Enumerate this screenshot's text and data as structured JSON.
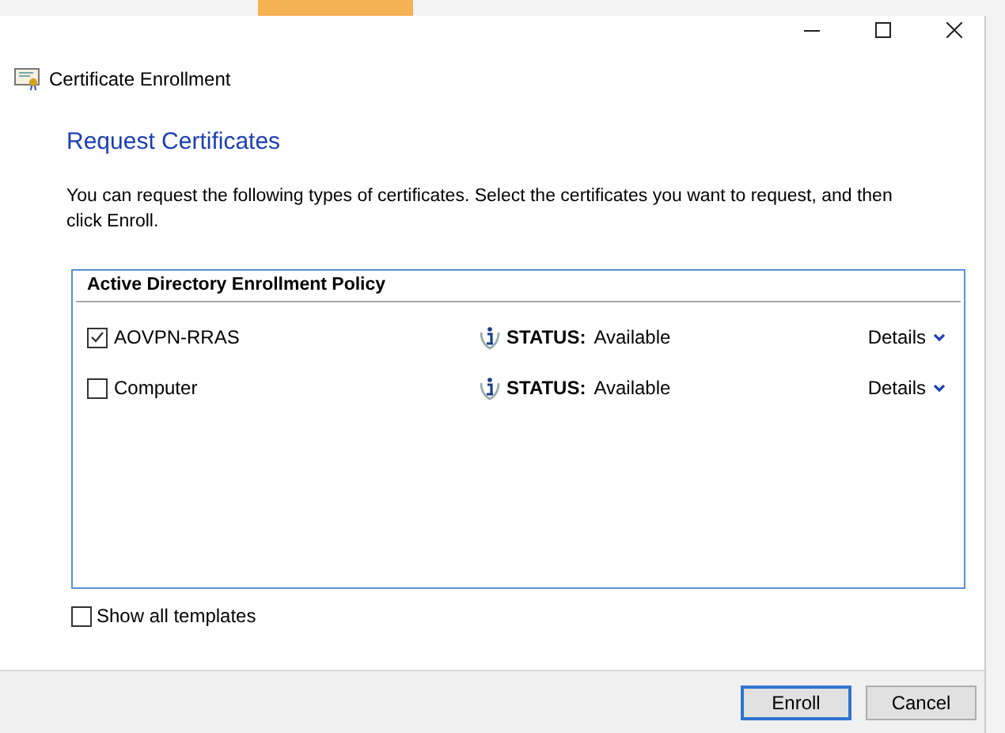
{
  "window": {
    "title": "Certificate Enrollment"
  },
  "heading": "Request Certificates",
  "description": "You can request the following types of certificates. Select the certificates you want to request, and then click Enroll.",
  "policy": {
    "title": "Active Directory Enrollment Policy",
    "certificates": [
      {
        "name": "AOVPN-RRAS",
        "checked": true,
        "status_label": "STATUS:",
        "status": "Available",
        "details": "Details"
      },
      {
        "name": "Computer",
        "checked": false,
        "status_label": "STATUS:",
        "status": "Available",
        "details": "Details"
      }
    ]
  },
  "show_all_templates": {
    "label": "Show all templates",
    "checked": false
  },
  "buttons": [
    {
      "label": "Enroll",
      "default": true
    },
    {
      "label": "Cancel",
      "default": false
    }
  ]
}
